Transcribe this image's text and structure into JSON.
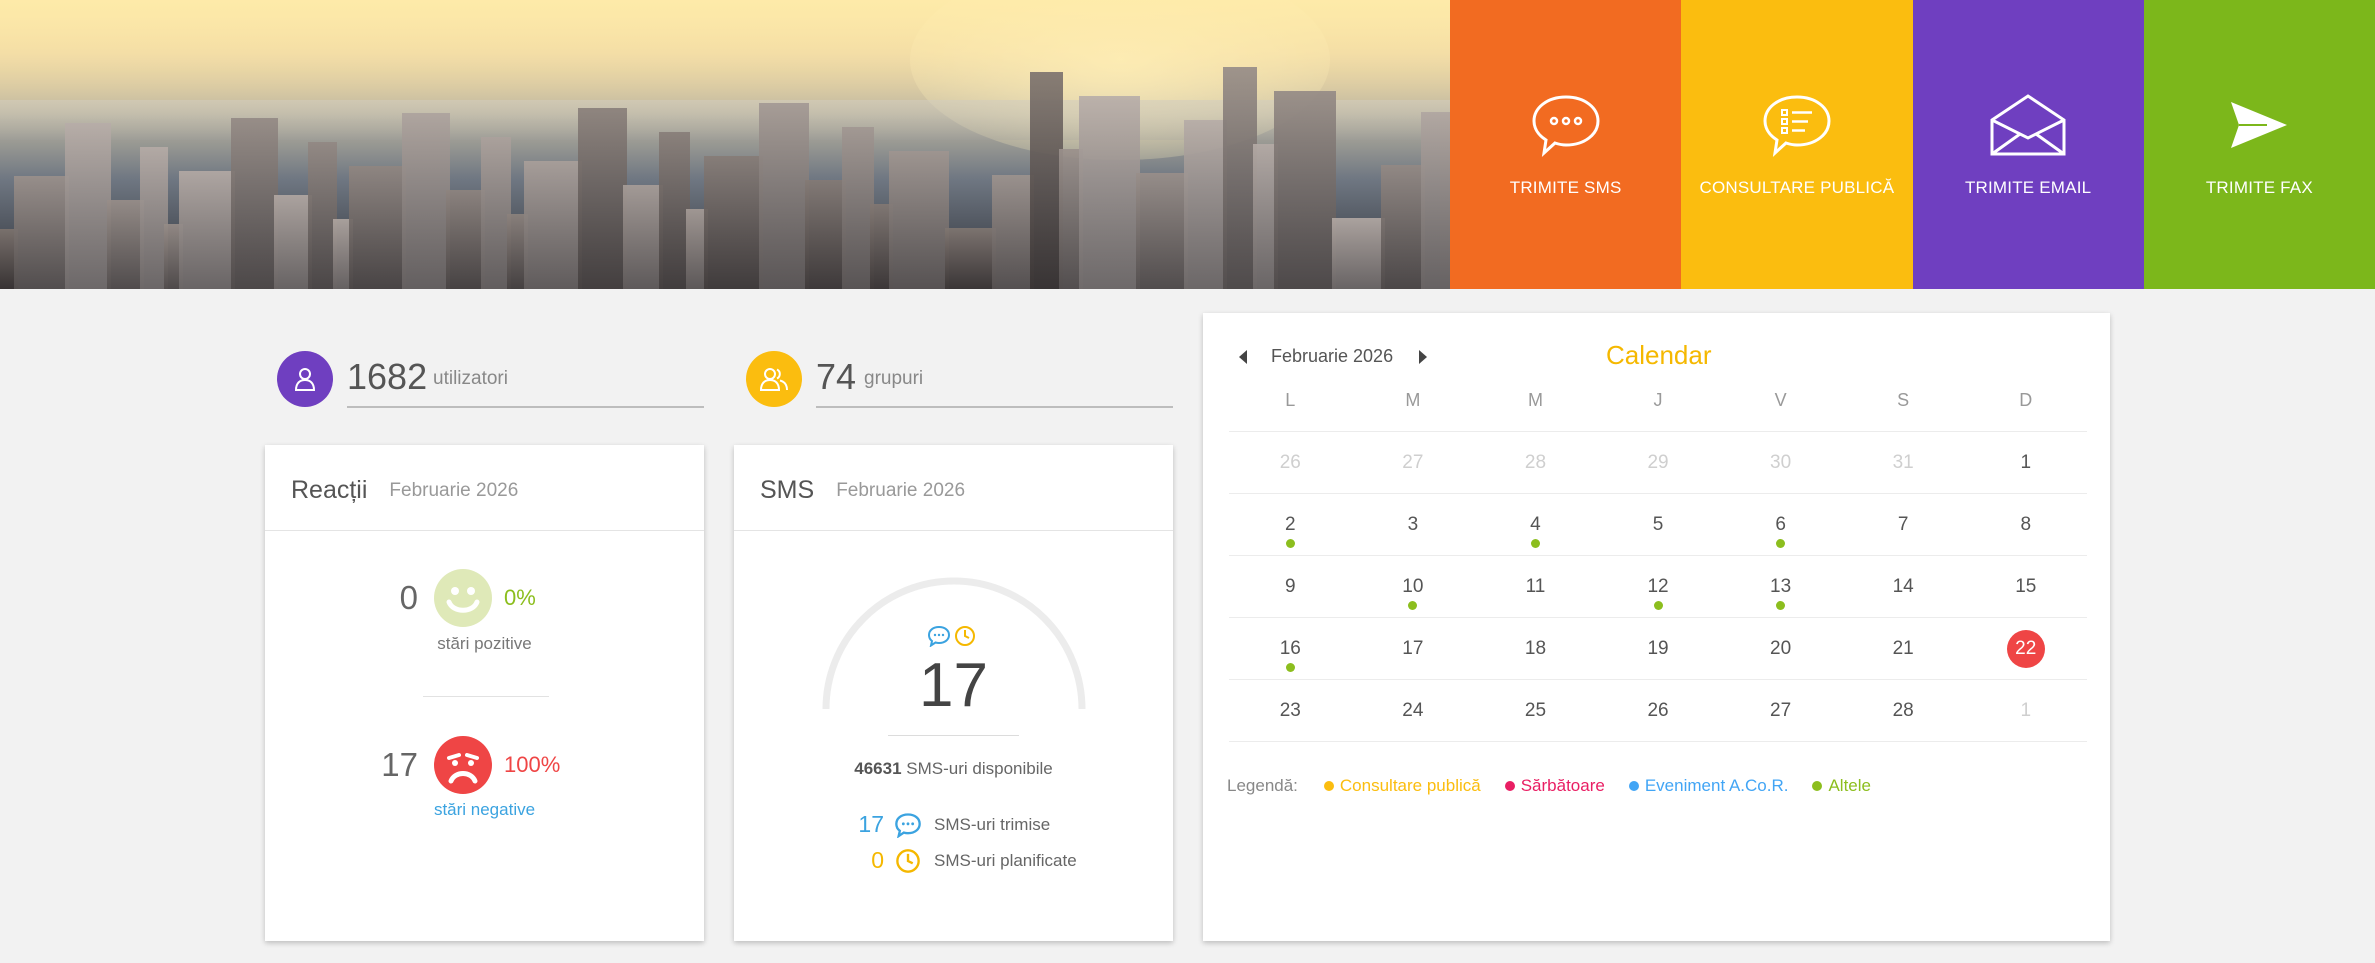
{
  "header": {
    "tiles": [
      {
        "label": "TRIMITE SMS",
        "color": "#f26b21",
        "icon": "sms-bubble-icon"
      },
      {
        "label": "CONSULTARE PUBLICĂ",
        "color": "#fbbd0f",
        "icon": "list-bubble-icon"
      },
      {
        "label": "TRIMITE EMAIL",
        "color": "#6f3fc0",
        "icon": "envelope-icon"
      },
      {
        "label": "TRIMITE FAX",
        "color": "#7cb71b",
        "icon": "paper-plane-icon"
      }
    ]
  },
  "stats": {
    "users": {
      "value": "1682",
      "label": "utilizatori",
      "color": "#6f3fc0",
      "icon": "user-icon"
    },
    "groups": {
      "value": "74",
      "label": "grupuri",
      "color": "#fbbd0f",
      "icon": "group-icon"
    }
  },
  "reactions": {
    "title": "Reacții",
    "period": "Februarie 2026",
    "positive": {
      "count": "0",
      "percent": "0%",
      "caption": "stări pozitive",
      "color": "#8cbe1e"
    },
    "negative": {
      "count": "17",
      "percent": "100%",
      "caption": "stări negative",
      "color": "#ef4545"
    }
  },
  "sms": {
    "title": "SMS",
    "period": "Februarie 2026",
    "gauge_value": "17",
    "available_count": "46631",
    "available_label": "SMS-uri disponibile",
    "sent_count": "17",
    "sent_label": "SMS-uri trimise",
    "scheduled_count": "0",
    "scheduled_label": "SMS-uri planificate"
  },
  "calendar": {
    "month": "Februarie 2026",
    "title": "Calendar",
    "weekdays": [
      "L",
      "M",
      "M",
      "J",
      "V",
      "S",
      "D"
    ],
    "weeks": [
      [
        {
          "d": "26",
          "other": true
        },
        {
          "d": "27",
          "other": true
        },
        {
          "d": "28",
          "other": true
        },
        {
          "d": "29",
          "other": true
        },
        {
          "d": "30",
          "other": true
        },
        {
          "d": "31",
          "other": true
        },
        {
          "d": "1"
        }
      ],
      [
        {
          "d": "2",
          "dot": true
        },
        {
          "d": "3"
        },
        {
          "d": "4",
          "dot": true
        },
        {
          "d": "5"
        },
        {
          "d": "6",
          "dot": true
        },
        {
          "d": "7"
        },
        {
          "d": "8"
        }
      ],
      [
        {
          "d": "9"
        },
        {
          "d": "10",
          "dot": true
        },
        {
          "d": "11"
        },
        {
          "d": "12",
          "dot": true
        },
        {
          "d": "13",
          "dot": true
        },
        {
          "d": "14"
        },
        {
          "d": "15"
        }
      ],
      [
        {
          "d": "16",
          "dot": true
        },
        {
          "d": "17"
        },
        {
          "d": "18"
        },
        {
          "d": "19"
        },
        {
          "d": "20"
        },
        {
          "d": "21"
        },
        {
          "d": "22",
          "today": true
        }
      ],
      [
        {
          "d": "23"
        },
        {
          "d": "24"
        },
        {
          "d": "25"
        },
        {
          "d": "26"
        },
        {
          "d": "27"
        },
        {
          "d": "28"
        },
        {
          "d": "1",
          "other": true
        }
      ]
    ],
    "legend_title": "Legendă:",
    "legend": [
      {
        "label": "Consultare publică",
        "color": "#fbbd0f"
      },
      {
        "label": "Sărbătoare",
        "color": "#e91e63"
      },
      {
        "label": "Eveniment A.Co.R.",
        "color": "#42a5f5"
      },
      {
        "label": "Altele",
        "color": "#8cbe1e"
      }
    ]
  }
}
